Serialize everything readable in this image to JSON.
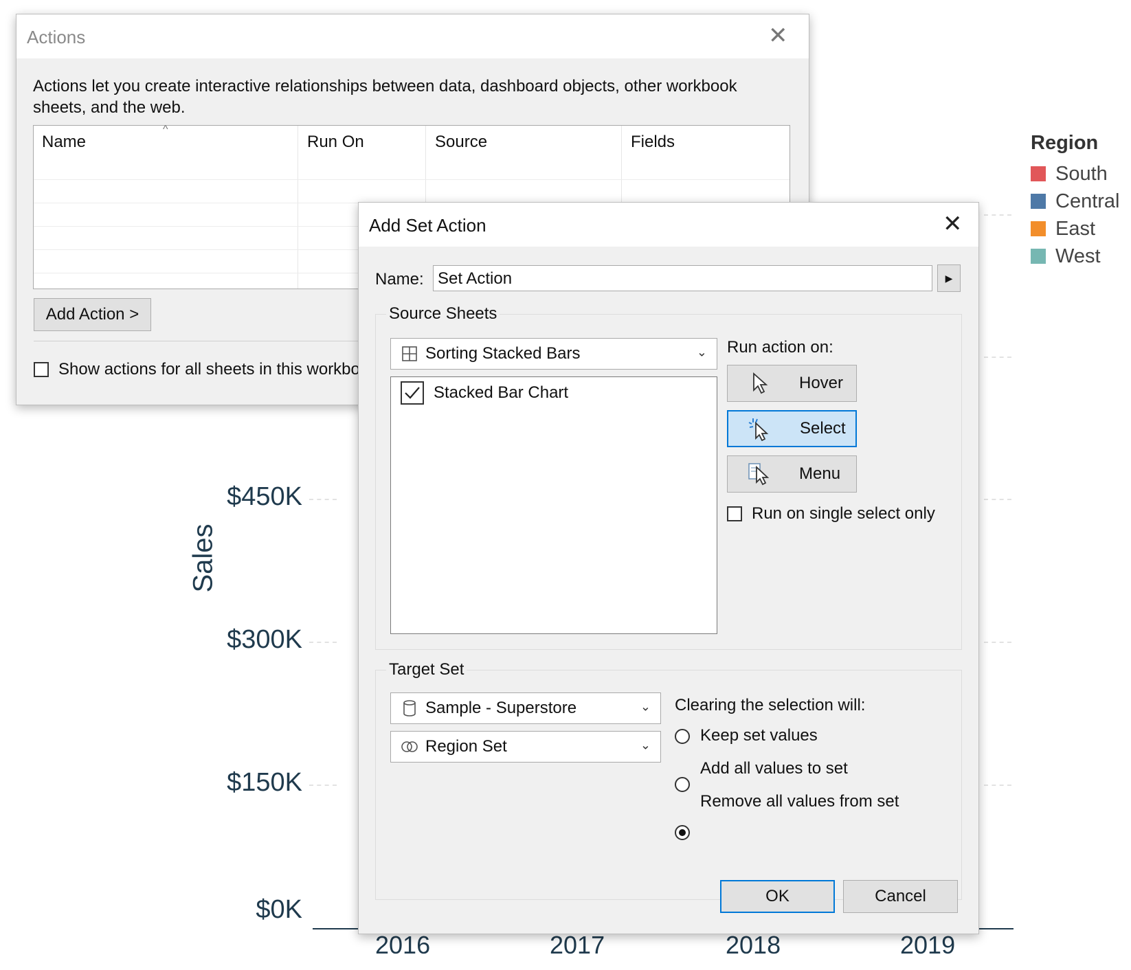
{
  "chart": {
    "y_title": "Sales",
    "y_ticks": [
      "$450K",
      "$300K",
      "$150K",
      "$0K"
    ],
    "years": [
      "2016",
      "2017",
      "2018",
      "2019"
    ],
    "legend": {
      "title": "Region",
      "items": [
        {
          "label": "South",
          "color": "#e15759"
        },
        {
          "label": "Central",
          "color": "#4e79a7"
        },
        {
          "label": "East",
          "color": "#f28e2b"
        },
        {
          "label": "West",
          "color": "#76b7b2"
        }
      ]
    }
  },
  "actions_dialog": {
    "title": "Actions",
    "description": "Actions let you create interactive relationships between data, dashboard objects, other workbook sheets, and the web.",
    "columns": [
      "Name",
      "Run On",
      "Source",
      "Fields"
    ],
    "add_action_label": "Add Action >",
    "show_all_label": "Show actions for all sheets in this workbo"
  },
  "set_action_dialog": {
    "title": "Add Set Action",
    "name_label": "Name:",
    "name_value": "Set Action",
    "source_sheets": {
      "group_label": "Source Sheets",
      "dropdown_value": "Sorting Stacked Bars",
      "items": [
        {
          "label": "Stacked Bar Chart",
          "checked": true
        }
      ]
    },
    "run_action_on": {
      "label": "Run action on:",
      "options": [
        "Hover",
        "Select",
        "Menu"
      ],
      "selected": "Select",
      "single_select_label": "Run on single select only"
    },
    "target_set": {
      "group_label": "Target Set",
      "datasource_value": "Sample - Superstore",
      "set_value": "Region Set",
      "clearing_label": "Clearing the selection will:",
      "clearing_options": [
        "Keep set values",
        "Add all values to set",
        "Remove all values from set"
      ],
      "clearing_selected": "Remove all values from set"
    },
    "ok_label": "OK",
    "cancel_label": "Cancel"
  }
}
